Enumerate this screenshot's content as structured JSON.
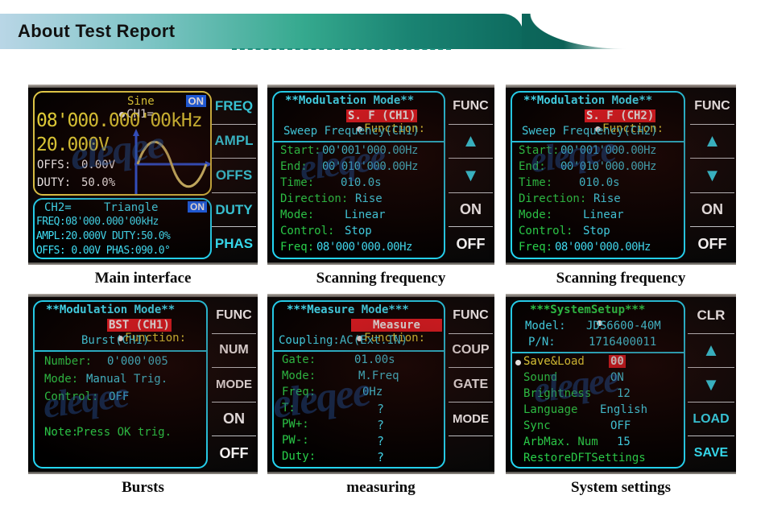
{
  "header": {
    "title": "About Test Report"
  },
  "panels": [
    {
      "id": "main-interface",
      "caption": "Main interface",
      "ch1": {
        "label": "CH1=",
        "wave": "Sine",
        "state": "ON",
        "freq": "08'000.000'00kHz",
        "ampl": "20.000V",
        "offs_label": "OFFS:",
        "offs_value": "0.00V",
        "duty_label": "DUTY:",
        "duty_value": "50.0%"
      },
      "ch2": {
        "label": "CH2=",
        "wave": "Triangle",
        "state": "ON",
        "line1": "FREQ:08'000.000'00kHz",
        "line2": "AMPL:20.000V DUTY:50.0%",
        "line3": "OFFS: 0.00V PHAS:090.0°"
      },
      "keys": [
        "FREQ",
        "AMPL",
        "OFFS",
        "DUTY",
        "PHAS"
      ]
    },
    {
      "id": "sweep-ch1",
      "caption": "Scanning frequency",
      "title": "**Modulation Mode**",
      "function_label": "Function:",
      "function_value": "S. F (CH1)",
      "subtitle": "Sweep Frequency(CH1)",
      "rows": [
        {
          "label": "Start:",
          "value": "00'001'000.00Hz"
        },
        {
          "label": "End:",
          "value": "00'010'000.00Hz"
        },
        {
          "label": "Time:",
          "value": "010.0s"
        },
        {
          "label": "Direction:",
          "value": "Rise"
        },
        {
          "label": "Mode:",
          "value": "Linear"
        },
        {
          "label": "Control:",
          "value": "Stop"
        },
        {
          "label": "Freq:",
          "value": "08'000'000.00Hz"
        }
      ],
      "keys": [
        "FUNC",
        "▲",
        "▼",
        "ON",
        "OFF"
      ]
    },
    {
      "id": "sweep-ch2",
      "caption": "Scanning frequency",
      "title": "**Modulation Mode**",
      "function_label": "Function:",
      "function_value": "S. F (CH2)",
      "subtitle": "Sweep Frequency(CH2)",
      "rows": [
        {
          "label": "Start:",
          "value": "00'001'000.00Hz"
        },
        {
          "label": "End:",
          "value": "00'010'000.00Hz"
        },
        {
          "label": "Time:",
          "value": "010.0s"
        },
        {
          "label": "Direction:",
          "value": "Rise"
        },
        {
          "label": "Mode:",
          "value": "Linear"
        },
        {
          "label": "Control:",
          "value": "Stop"
        },
        {
          "label": "Freq:",
          "value": "08'000'000.00Hz"
        }
      ],
      "keys": [
        "FUNC",
        "▲",
        "▼",
        "ON",
        "OFF"
      ]
    },
    {
      "id": "burst",
      "caption": "Bursts",
      "title": "**Modulation Mode**",
      "function_label": "Function:",
      "function_value": "BST (CH1)",
      "subtitle": "Burst(CH1)",
      "rows": [
        {
          "label": "Number:",
          "value": "0'000'005"
        },
        {
          "label": "Mode:",
          "value": "Manual Trig."
        },
        {
          "label": "Control:",
          "value": "OFF"
        },
        {
          "label": "",
          "value": ""
        },
        {
          "label": "Note:",
          "value": "Press OK trig.",
          "note": true
        }
      ],
      "keys": [
        "FUNC",
        "NUM",
        "MODE",
        "ON",
        "OFF"
      ]
    },
    {
      "id": "measure",
      "caption": "measuring",
      "title": "***Measure Mode***",
      "function_label": "Function:",
      "function_value": "Measure",
      "subtitle": "Coupling:AC(Ext.IN)",
      "rows": [
        {
          "label": "Gate:",
          "value": "01.00s"
        },
        {
          "label": "Mode:",
          "value": "M.Freq"
        },
        {
          "label": "Freq:",
          "value": "0Hz"
        },
        {
          "label": "T:",
          "value": "?"
        },
        {
          "label": "PW+:",
          "value": "?"
        },
        {
          "label": "PW-:",
          "value": "?"
        },
        {
          "label": "Duty:",
          "value": "?"
        }
      ],
      "keys": [
        "FUNC",
        "COUP",
        "GATE",
        "MODE",
        ""
      ]
    },
    {
      "id": "system-setup",
      "caption": "System settings",
      "title": "***SystemSetup***",
      "model_label": "Model:",
      "model_value": "JDS6600-40M",
      "pn_label": "P/N:",
      "pn_value": "1716400011",
      "rows": [
        {
          "label": "Save&Load",
          "value": "00",
          "highlight": true,
          "selected": true
        },
        {
          "label": "Sound",
          "value": "ON"
        },
        {
          "label": "Brightness",
          "value": "12"
        },
        {
          "label": "Language",
          "value": "English"
        },
        {
          "label": "Sync",
          "value": "OFF"
        },
        {
          "label": "ArbMax. Num",
          "value": "15"
        },
        {
          "label": "RestoreDFTSettings",
          "value": ""
        }
      ],
      "keys": [
        "CLR",
        "▲",
        "▼",
        "LOAD",
        "SAVE"
      ]
    }
  ],
  "watermark": "eleqee",
  "colors": {
    "cyan": "#3fe4fb",
    "green": "#28d24a",
    "yellow": "#f2e23c",
    "red_highlight": "#ec1c24",
    "blue_highlight": "#1668ff",
    "banner_start": "#b9d6e6",
    "banner_end": "#0d6a5e"
  }
}
